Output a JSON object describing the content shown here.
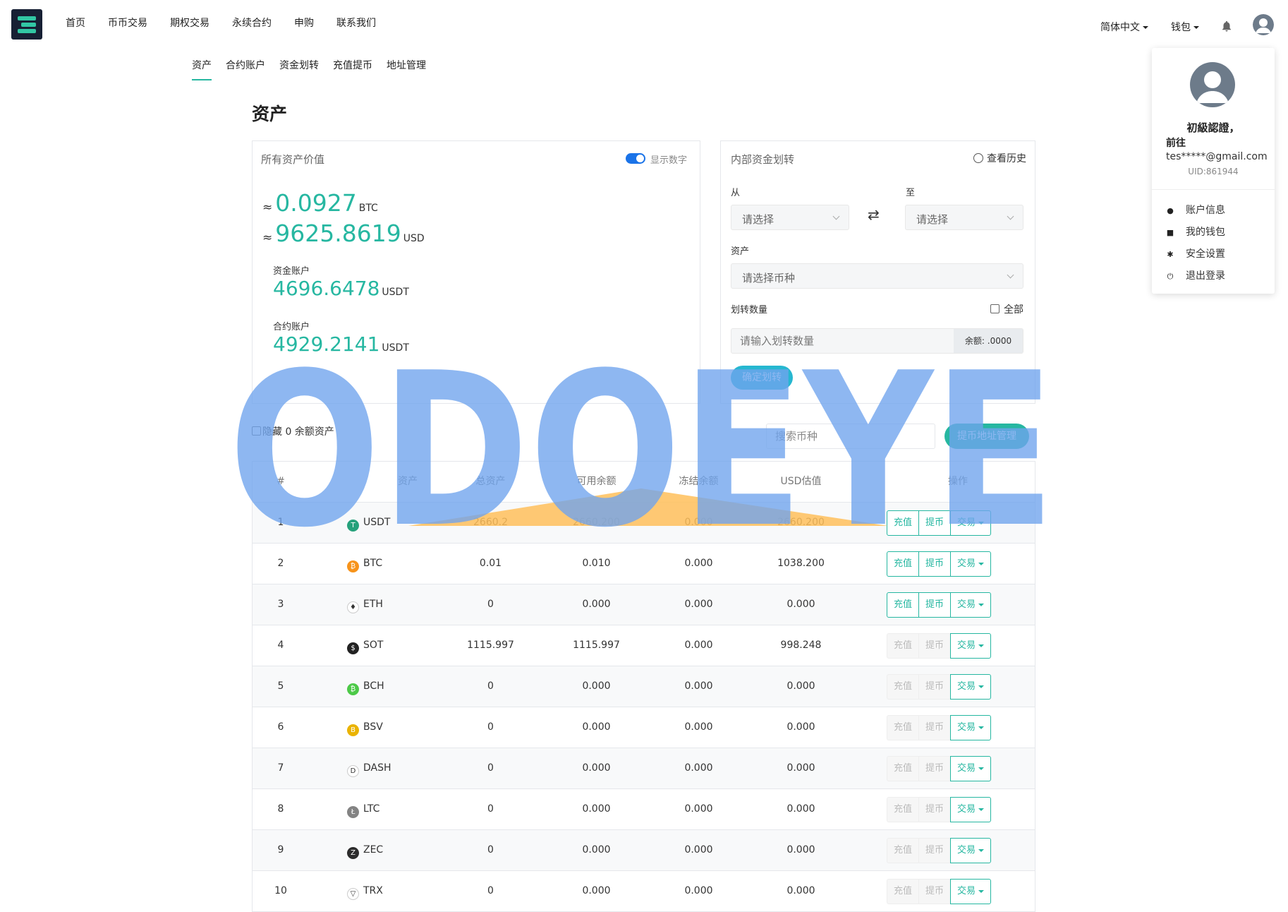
{
  "nav": {
    "items": [
      "首页",
      "币币交易",
      "期权交易",
      "永续合约",
      "申购",
      "联系我们"
    ],
    "language": "简体中文",
    "wallet": "钱包"
  },
  "subnav": [
    "资产",
    "合约账户",
    "资金划转",
    "充值提币",
    "地址管理"
  ],
  "page_title": "资产",
  "assets_card": {
    "title": "所有资产价值",
    "toggle_label": "显示数字",
    "approx": "≈",
    "btc_value": "0.0927",
    "btc_unit": "BTC",
    "usd_value": "9625.8619",
    "usd_unit": "USD",
    "fund_label": "资金账户",
    "fund_value": "4696.6478",
    "fund_unit": "USDT",
    "contract_label": "合约账户",
    "contract_value": "4929.2141",
    "contract_unit": "USDT"
  },
  "transfer_card": {
    "title": "内部资金划转",
    "history": "查看历史",
    "from_label": "从",
    "to_label": "至",
    "from_placeholder": "请选择",
    "to_placeholder": "请选择",
    "asset_label": "资产",
    "asset_placeholder": "请选择币种",
    "amount_label": "划转数量",
    "all_label": "全部",
    "amount_placeholder": "请输入划转数量",
    "balance": "余额: .0000",
    "confirm": "确定划转"
  },
  "filter": {
    "hide_zero": "隐藏 0 余额资产",
    "search_placeholder": "搜索币种",
    "address_button": "提币地址管理"
  },
  "table": {
    "headers": [
      "#",
      "资产",
      "总资产",
      "可用余额",
      "冻结余额",
      "USD估值",
      "操作"
    ],
    "buttons": {
      "deposit": "充值",
      "withdraw": "提币",
      "trade": "交易"
    },
    "rows": [
      {
        "idx": "1",
        "coin": "USDT",
        "total": "2660.2",
        "avail": "2660.200",
        "frozen": "0.000",
        "usd": "2660.200",
        "enabled": true,
        "color": "#26a17b",
        "glyph": "T"
      },
      {
        "idx": "2",
        "coin": "BTC",
        "total": "0.01",
        "avail": "0.010",
        "frozen": "0.000",
        "usd": "1038.200",
        "enabled": true,
        "color": "#f7931a",
        "glyph": "₿"
      },
      {
        "idx": "3",
        "coin": "ETH",
        "total": "0",
        "avail": "0.000",
        "frozen": "0.000",
        "usd": "0.000",
        "enabled": true,
        "color": "#ffffff",
        "glyph": "♦"
      },
      {
        "idx": "4",
        "coin": "SOT",
        "total": "1115.997",
        "avail": "1115.997",
        "frozen": "0.000",
        "usd": "998.248",
        "enabled": false,
        "color": "#222222",
        "glyph": "$"
      },
      {
        "idx": "5",
        "coin": "BCH",
        "total": "0",
        "avail": "0.000",
        "frozen": "0.000",
        "usd": "0.000",
        "enabled": false,
        "color": "#4cc947",
        "glyph": "₿"
      },
      {
        "idx": "6",
        "coin": "BSV",
        "total": "0",
        "avail": "0.000",
        "frozen": "0.000",
        "usd": "0.000",
        "enabled": false,
        "color": "#eab300",
        "glyph": "B"
      },
      {
        "idx": "7",
        "coin": "DASH",
        "total": "0",
        "avail": "0.000",
        "frozen": "0.000",
        "usd": "0.000",
        "enabled": false,
        "color": "#ffffff",
        "glyph": "D"
      },
      {
        "idx": "8",
        "coin": "LTC",
        "total": "0",
        "avail": "0.000",
        "frozen": "0.000",
        "usd": "0.000",
        "enabled": false,
        "color": "#838383",
        "glyph": "Ł"
      },
      {
        "idx": "9",
        "coin": "ZEC",
        "total": "0",
        "avail": "0.000",
        "frozen": "0.000",
        "usd": "0.000",
        "enabled": false,
        "color": "#2c2c2c",
        "glyph": "Z"
      },
      {
        "idx": "10",
        "coin": "TRX",
        "total": "0",
        "avail": "0.000",
        "frozen": "0.000",
        "usd": "0.000",
        "enabled": false,
        "color": "#ffffff",
        "glyph": "▽"
      }
    ]
  },
  "user_menu": {
    "name": "初級認證，",
    "go": "前往",
    "email": "tes*****@gmail.com",
    "uid": "UID:861944",
    "items": [
      "账户信息",
      "我的钱包",
      "安全设置",
      "退出登录"
    ]
  },
  "watermark": "ODOEYE",
  "colors": {
    "accent": "#26b7a1",
    "watermark_blue": "#6fa4ee",
    "watermark_orange": "#ffc05a"
  }
}
